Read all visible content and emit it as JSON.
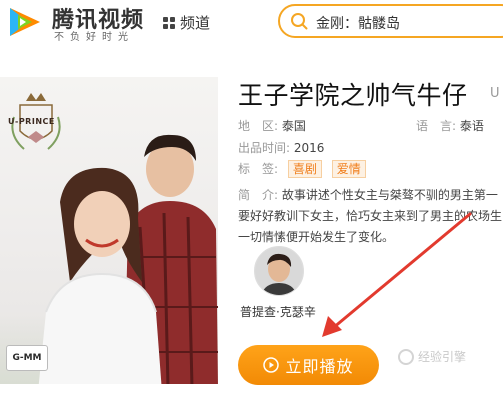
{
  "header": {
    "logo_text": "腾讯视频",
    "logo_slogan": "不负好时光",
    "channel_label": "频道",
    "search_value": "金刚：骷髅岛"
  },
  "show": {
    "title": "王子学院之帅气牛仔",
    "title_overflow": "U",
    "region_label": "地　区:",
    "region_value": "泰国",
    "language_label": "语　言:",
    "language_value": "泰语",
    "year_label": "出品时间:",
    "year_value": "2016",
    "tags_label": "标　签:",
    "tags": [
      "喜剧",
      "爱情"
    ],
    "desc_label": "简　介:",
    "desc_lines": [
      "故事讲述个性女主与桀骜不驯的男主第一",
      "要好好教训下女主，恰巧女主来到了男主的农场生",
      "一切情愫便开始发生了变化。"
    ],
    "actor_name": "普提查·克瑟辛",
    "play_label": "立即播放"
  },
  "poster": {
    "crest_text": "U-PRINCE",
    "studio_logo": "G-MM"
  },
  "watermark": "经验引擎",
  "colors": {
    "accent": "#f5a623",
    "play_button": "#f28a05",
    "arrow": "#e23a2e",
    "tag_text": "#f07d1a"
  }
}
